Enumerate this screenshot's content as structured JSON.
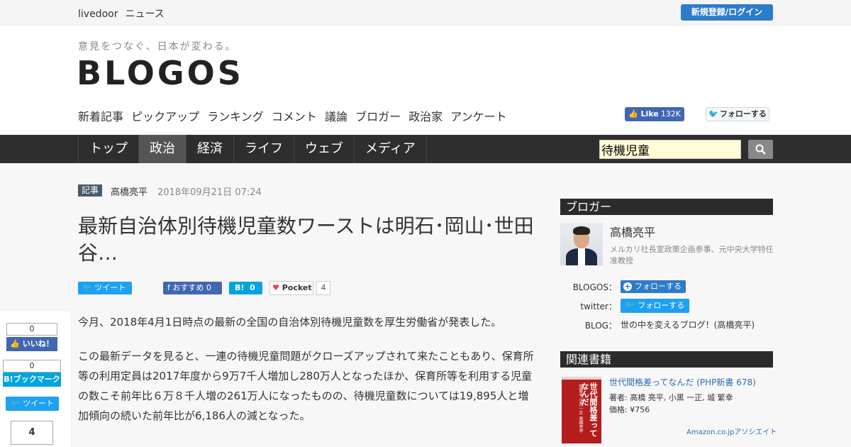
{
  "topbar": {
    "brand1": "livedoor",
    "brand2": "ニュース",
    "login": "新規登録/ログイン"
  },
  "header": {
    "tagline": "意見をつなぐ、日本が変わる。",
    "logo": "BLOGOS",
    "subnav": [
      "新着記事",
      "ピックアップ",
      "ランキング",
      "コメント",
      "議論",
      "ブロガー",
      "政治家",
      "アンケート"
    ],
    "fb_like_label": "Like",
    "fb_like_count": "132K",
    "tw_follow": "フォローする"
  },
  "mainnav": {
    "items": [
      "トップ",
      "政治",
      "経済",
      "ライフ",
      "ウェブ",
      "メディア"
    ],
    "active": "政治"
  },
  "search": {
    "value": "待機児童"
  },
  "article": {
    "tag": "記事",
    "author": "高橋亮平",
    "date": "2018年09月21日 07:24",
    "title": "最新自治体別待機児童数ワーストは明石･岡山･世田谷…",
    "share": {
      "tweet": "ツイート",
      "recommend": "おすすめ",
      "recommend_count": "0",
      "hatena": "B!",
      "hatena_count": "0",
      "pocket": "Pocket",
      "pocket_count": "4"
    },
    "paragraphs": [
      "今月、2018年4月1日時点の最新の全国の自治体別待機児童数を厚生労働省が発表した。",
      "この最新データを見ると、一連の待機児童問題がクローズアップされて来たこともあり、保育所等の利用定員は2017年度から9万7千人増加し280万人となったほか、保育所等を利用する児童の数こそ前年比６万８千人増の261万人になったものの、待機児童数については19,895人と増加傾向の続いた前年比が6,186人の減となった。"
    ]
  },
  "float_share": {
    "like_count": "0",
    "like": "いいね！",
    "hb_count": "0",
    "hb": "B!ブックマーク",
    "tweet": "ツイート",
    "pocket_count": "4"
  },
  "sidebar": {
    "blogger_head": "ブロガー",
    "blogger_name": "高橋亮平",
    "blogger_desc": "メルカリ社長室政策企画参事、元中央大学特任准教授",
    "blogos_label": "BLOGOS：",
    "blogos_follow": "フォローする",
    "twitter_label": "twitter：",
    "twitter_follow": "フォローする",
    "blog_label": "BLOG：",
    "blog_name": "世の中を変えるブログ！(高橋亮平)",
    "books_head": "関連書籍",
    "book_title": "世代間格差ってなんだ (PHP新書 678)",
    "book_authors": "著者: 高橋 亮平, 小黒 一正, 城 繁幸",
    "book_price": "価格: ¥756",
    "book_cover_title": "世代間格差ってなんだ",
    "book_cover_authors": "城繁幸 小黒一正 高橋亮平",
    "amazon": "Amazon.co.jpアソシエイト"
  }
}
